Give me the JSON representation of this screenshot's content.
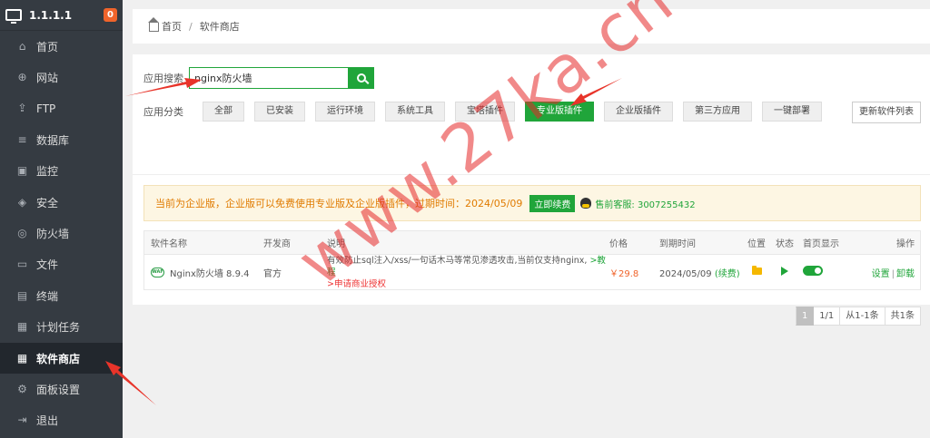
{
  "server": {
    "ip": "1.1.1.1",
    "badge": "0"
  },
  "sidebar": {
    "items": [
      {
        "label": "首页",
        "icon": "home-icon",
        "glyph": "⌂"
      },
      {
        "label": "网站",
        "icon": "globe-icon",
        "glyph": "⊕"
      },
      {
        "label": "FTP",
        "icon": "ftp-icon",
        "glyph": "⇪"
      },
      {
        "label": "数据库",
        "icon": "database-icon",
        "glyph": "≡"
      },
      {
        "label": "监控",
        "icon": "monitor-icon",
        "glyph": "▣"
      },
      {
        "label": "安全",
        "icon": "shield-icon",
        "glyph": "◈"
      },
      {
        "label": "防火墙",
        "icon": "firewall-icon",
        "glyph": "◎"
      },
      {
        "label": "文件",
        "icon": "folder-icon",
        "glyph": "▭"
      },
      {
        "label": "终端",
        "icon": "terminal-icon",
        "glyph": "▤"
      },
      {
        "label": "计划任务",
        "icon": "calendar-icon",
        "glyph": "▦"
      },
      {
        "label": "软件商店",
        "icon": "apps-icon",
        "glyph": "▦",
        "active": true
      },
      {
        "label": "面板设置",
        "icon": "gear-icon",
        "glyph": "⚙"
      },
      {
        "label": "退出",
        "icon": "logout-icon",
        "glyph": "⇥"
      }
    ]
  },
  "breadcrumb": {
    "home": "首页",
    "separator": "/",
    "current": "软件商店"
  },
  "search": {
    "label": "应用搜索",
    "value": "nginx防火墙"
  },
  "categories": {
    "label": "应用分类",
    "items": [
      "全部",
      "已安装",
      "运行环境",
      "系统工具",
      "宝塔插件",
      "专业版插件",
      "企业版插件",
      "第三方应用",
      "一键部署"
    ],
    "selected": "专业版插件"
  },
  "refresh_label": "更新软件列表",
  "notice": {
    "text": "当前为企业版，企业版可以免费使用专业版及企业版插件，过期时间：2024/05/09",
    "renew": "立即续费",
    "service": "售前客服: 3007255432"
  },
  "table": {
    "headers": [
      "软件名称",
      "开发商",
      "说明",
      "价格",
      "到期时间",
      "位置",
      "状态",
      "首页显示",
      "操作"
    ],
    "rows": [
      {
        "name": "Nginx防火墙 8.9.4",
        "icon_text": "WAF",
        "developer": "官方",
        "desc": "有效防止sql注入/xss/一句话木马等常见渗透攻击,当前仅支持nginx,",
        "desc_link": ">教程",
        "desc_red": ">申请商业授权",
        "price": "￥29.8",
        "expire": "2024/05/09",
        "renew": "(续费)",
        "op_settings": "设置",
        "op_sep": "|",
        "op_uninstall": "卸载"
      }
    ]
  },
  "pager": {
    "current": "1",
    "pages": "1/1",
    "range": "从1-1条",
    "total": "共1条"
  },
  "watermark": "www.27ka.cn",
  "colors": {
    "accent": "#20a53a",
    "sidebar": "#353b42",
    "warn": "#e07b00",
    "arrow": "#e8342a"
  }
}
